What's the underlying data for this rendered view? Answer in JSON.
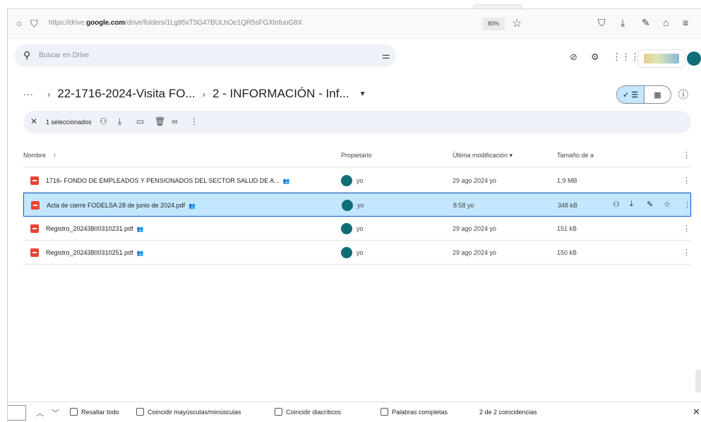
{
  "browser": {
    "url_prefix": "https://drive.",
    "url_domain": "google.com",
    "url_path": "/drive/folders/1Lg95xT5G47BULhOe1QR5sFGXtnfuoG8X",
    "zoom": "80%",
    "icons": [
      "circle-icon",
      "lock-icon",
      "star-icon",
      "pocket-icon",
      "download-icon",
      "extensions-icon",
      "home-icon",
      "menu-icon"
    ]
  },
  "drive": {
    "search_placeholder": "Buscar en Drive",
    "breadcrumb": {
      "more": "···",
      "parent": "22-1716-2024-Visita FO...",
      "current": "2 - INFORMACIÓN - Inf..."
    },
    "selection": {
      "count_label": "1 seleccionados"
    },
    "columns": {
      "name": "Nombre",
      "owner": "Propietario",
      "modified": "Última modificación",
      "size": "Tamaño de a"
    },
    "files": [
      {
        "name": "1716- FONDO DE EMPLEADOS Y PENSIONADOS DEL SECTOR SALUD DE A...",
        "owner": "yo",
        "modified": "29 ago 2024 yo",
        "size": "1,9 MB",
        "selected": false
      },
      {
        "name": "Acta de cierre FODELSA 28 de junio de 2024.pdf",
        "owner": "yo",
        "modified": "8:58 yo",
        "size": "348 kB",
        "selected": true
      },
      {
        "name": "Registro_20243800310231.pdf",
        "owner": "yo",
        "modified": "29 ago 2024 yo",
        "size": "151 kB",
        "selected": false
      },
      {
        "name": "Registro_20243800310251.pdf",
        "owner": "yo",
        "modified": "29 ago 2024 yo",
        "size": "150 kB",
        "selected": false
      }
    ]
  },
  "findbar": {
    "highlight_all": "Resaltar todo",
    "match_case": "Coincidir mayúsculas/minúsculas",
    "match_diacritics": "Coincidir diacríticos",
    "whole_words": "Palabras completas",
    "status": "2 de 2 coincidencias"
  },
  "colors": {
    "selected_row": "#c2e7ff",
    "selected_border": "#0b57d0",
    "pdf_red": "#ea4335",
    "search_bg": "#eef1f8",
    "avatar": "#0f6e78"
  }
}
